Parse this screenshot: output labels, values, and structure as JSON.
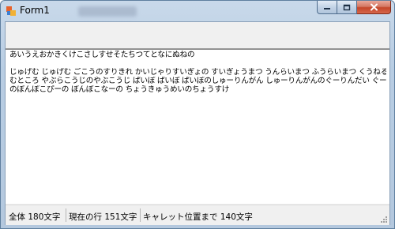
{
  "window": {
    "title": "Form1",
    "icon": "winforms-app-icon",
    "caption_buttons": [
      "minimize-icon",
      "maximize-icon",
      "close-icon"
    ]
  },
  "editor": {
    "lines": [
      "あいうえおかきくけこさしすせそたちつてとなにぬねの",
      "",
      "じゅげむ じゅげむ ごこうのすりきれ かいじゃりすいぎょの すいぎょうまつ うんらいまつ ふうらいまつ くうねるところにす",
      "むところ やぶらこうじのやぶこうじ ぱいぽ ぱいぽ ぱいぽのしゅーりんがん しゅーりんがんのぐーりんだい ぐーりんだい",
      "のぽんぽこぴーの ぽんぽこなーの ちょうきゅうめいのちょうすけ"
    ]
  },
  "statusbar": {
    "total": "全体 180文字",
    "current_line": "現在の行 151文字",
    "caret": "キャレット位置まで 140文字"
  }
}
